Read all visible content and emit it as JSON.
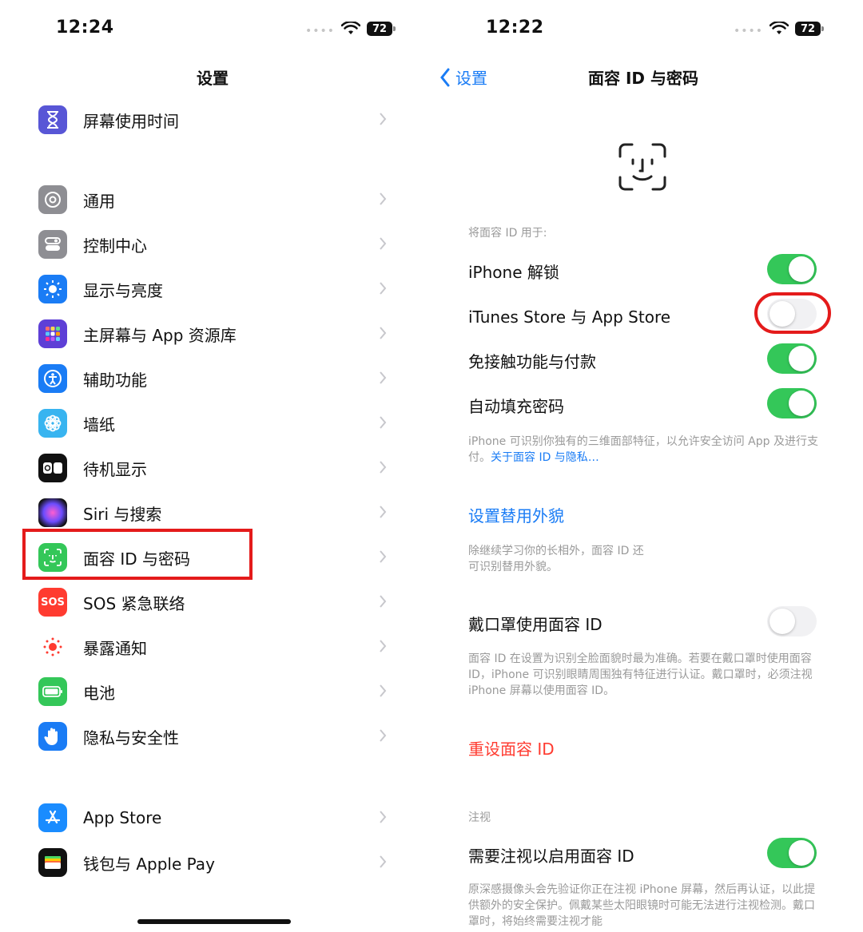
{
  "colors": {
    "accent": "#1a7cf5",
    "toggle_on": "#34c759",
    "destructive": "#ff3b30",
    "highlight": "#e41b1b"
  },
  "left": {
    "status_time": "12:24",
    "battery": "72",
    "title": "设置",
    "items": [
      {
        "label": "屏幕使用时间",
        "icon": "hourglass-icon"
      },
      {
        "label": "通用",
        "icon": "gear-icon"
      },
      {
        "label": "控制中心",
        "icon": "toggles-icon"
      },
      {
        "label": "显示与亮度",
        "icon": "sun-icon"
      },
      {
        "label": "主屏幕与 App 资源库",
        "icon": "app-grid-icon"
      },
      {
        "label": "辅助功能",
        "icon": "accessibility-icon"
      },
      {
        "label": "墙纸",
        "icon": "flower-icon"
      },
      {
        "label": "待机显示",
        "icon": "standby-icon"
      },
      {
        "label": "Siri 与搜索",
        "icon": "siri-icon"
      },
      {
        "label": "面容 ID 与密码",
        "icon": "face-id-icon"
      },
      {
        "label": "SOS 紧急联络",
        "icon": "sos-icon"
      },
      {
        "label": "暴露通知",
        "icon": "exposure-icon"
      },
      {
        "label": "电池",
        "icon": "battery-icon"
      },
      {
        "label": "隐私与安全性",
        "icon": "hand-icon"
      },
      {
        "label": "App Store",
        "icon": "app-store-icon"
      },
      {
        "label": "钱包与 Apple Pay",
        "icon": "wallet-icon"
      }
    ],
    "sos_icon_text": "SOS"
  },
  "right": {
    "status_time": "12:22",
    "battery": "72",
    "back_label": "设置",
    "title": "面容 ID 与密码",
    "use_for_header": "将面容 ID 用于:",
    "toggles": [
      {
        "label": "iPhone 解锁",
        "on": true
      },
      {
        "label": "iTunes Store 与 App Store",
        "on": false
      },
      {
        "label": "免接触功能与付款",
        "on": true
      },
      {
        "label": "自动填充密码",
        "on": true
      }
    ],
    "face_note": "iPhone 可识别你独有的三维面部特征，以允许安全访问 App 及进行支付。",
    "face_note_link": "关于面容 ID 与隐私…",
    "alt_appearance": "设置替用外貌",
    "alt_note": "除继续学习你的长相外，面容 ID 还可识别替用外貌。",
    "mask_label": "戴口罩使用面容 ID",
    "mask_on": false,
    "mask_note": "面容 ID 在设置为识别全脸面貌时最为准确。若要在戴口罩时使用面容 ID，iPhone 可识别眼睛周围独有特征进行认证。戴口罩时，必须注视 iPhone 屏幕以使用面容 ID。",
    "reset": "重设面容 ID",
    "attention_header": "注视",
    "attention_label": "需要注视以启用面容 ID",
    "attention_on": true,
    "attention_note": "原深感摄像头会先验证你正在注视 iPhone 屏幕，然后再认证，以此提供额外的安全保护。佩戴某些太阳眼镜时可能无法进行注视检测。戴口罩时，将始终需要注视才能"
  }
}
